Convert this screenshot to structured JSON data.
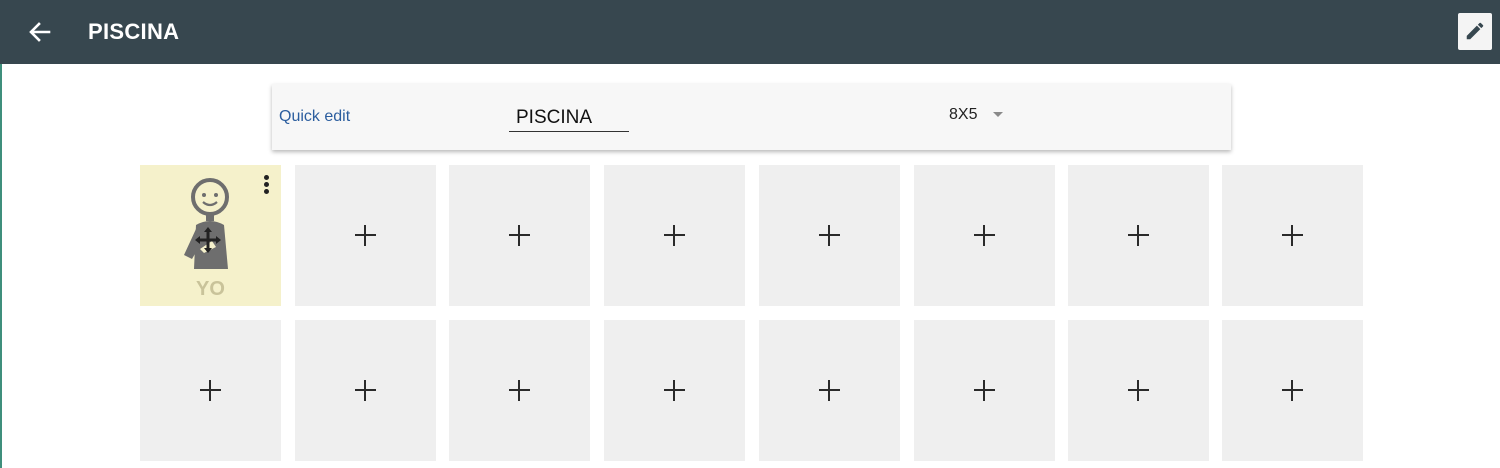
{
  "header": {
    "title": "PISCINA",
    "background": "#37474f"
  },
  "toolbar": {
    "quick_edit_label": "Quick edit",
    "name_value": "PISCINA",
    "size_value": "8X5"
  },
  "grid": {
    "columns": 8,
    "rows_visible": 2,
    "tiles": [
      {
        "label": "YO",
        "filled": true,
        "icon": "person-pictogram-icon",
        "color": "#f5f1cb"
      },
      {
        "label": "",
        "filled": false
      },
      {
        "label": "",
        "filled": false
      },
      {
        "label": "",
        "filled": false
      },
      {
        "label": "",
        "filled": false
      },
      {
        "label": "",
        "filled": false
      },
      {
        "label": "",
        "filled": false
      },
      {
        "label": "",
        "filled": false
      },
      {
        "label": "",
        "filled": false
      },
      {
        "label": "",
        "filled": false
      },
      {
        "label": "",
        "filled": false
      },
      {
        "label": "",
        "filled": false
      },
      {
        "label": "",
        "filled": false
      },
      {
        "label": "",
        "filled": false
      },
      {
        "label": "",
        "filled": false
      },
      {
        "label": "",
        "filled": false
      }
    ],
    "empty_tile_icon": "plus-icon",
    "empty_color": "#efefef"
  }
}
